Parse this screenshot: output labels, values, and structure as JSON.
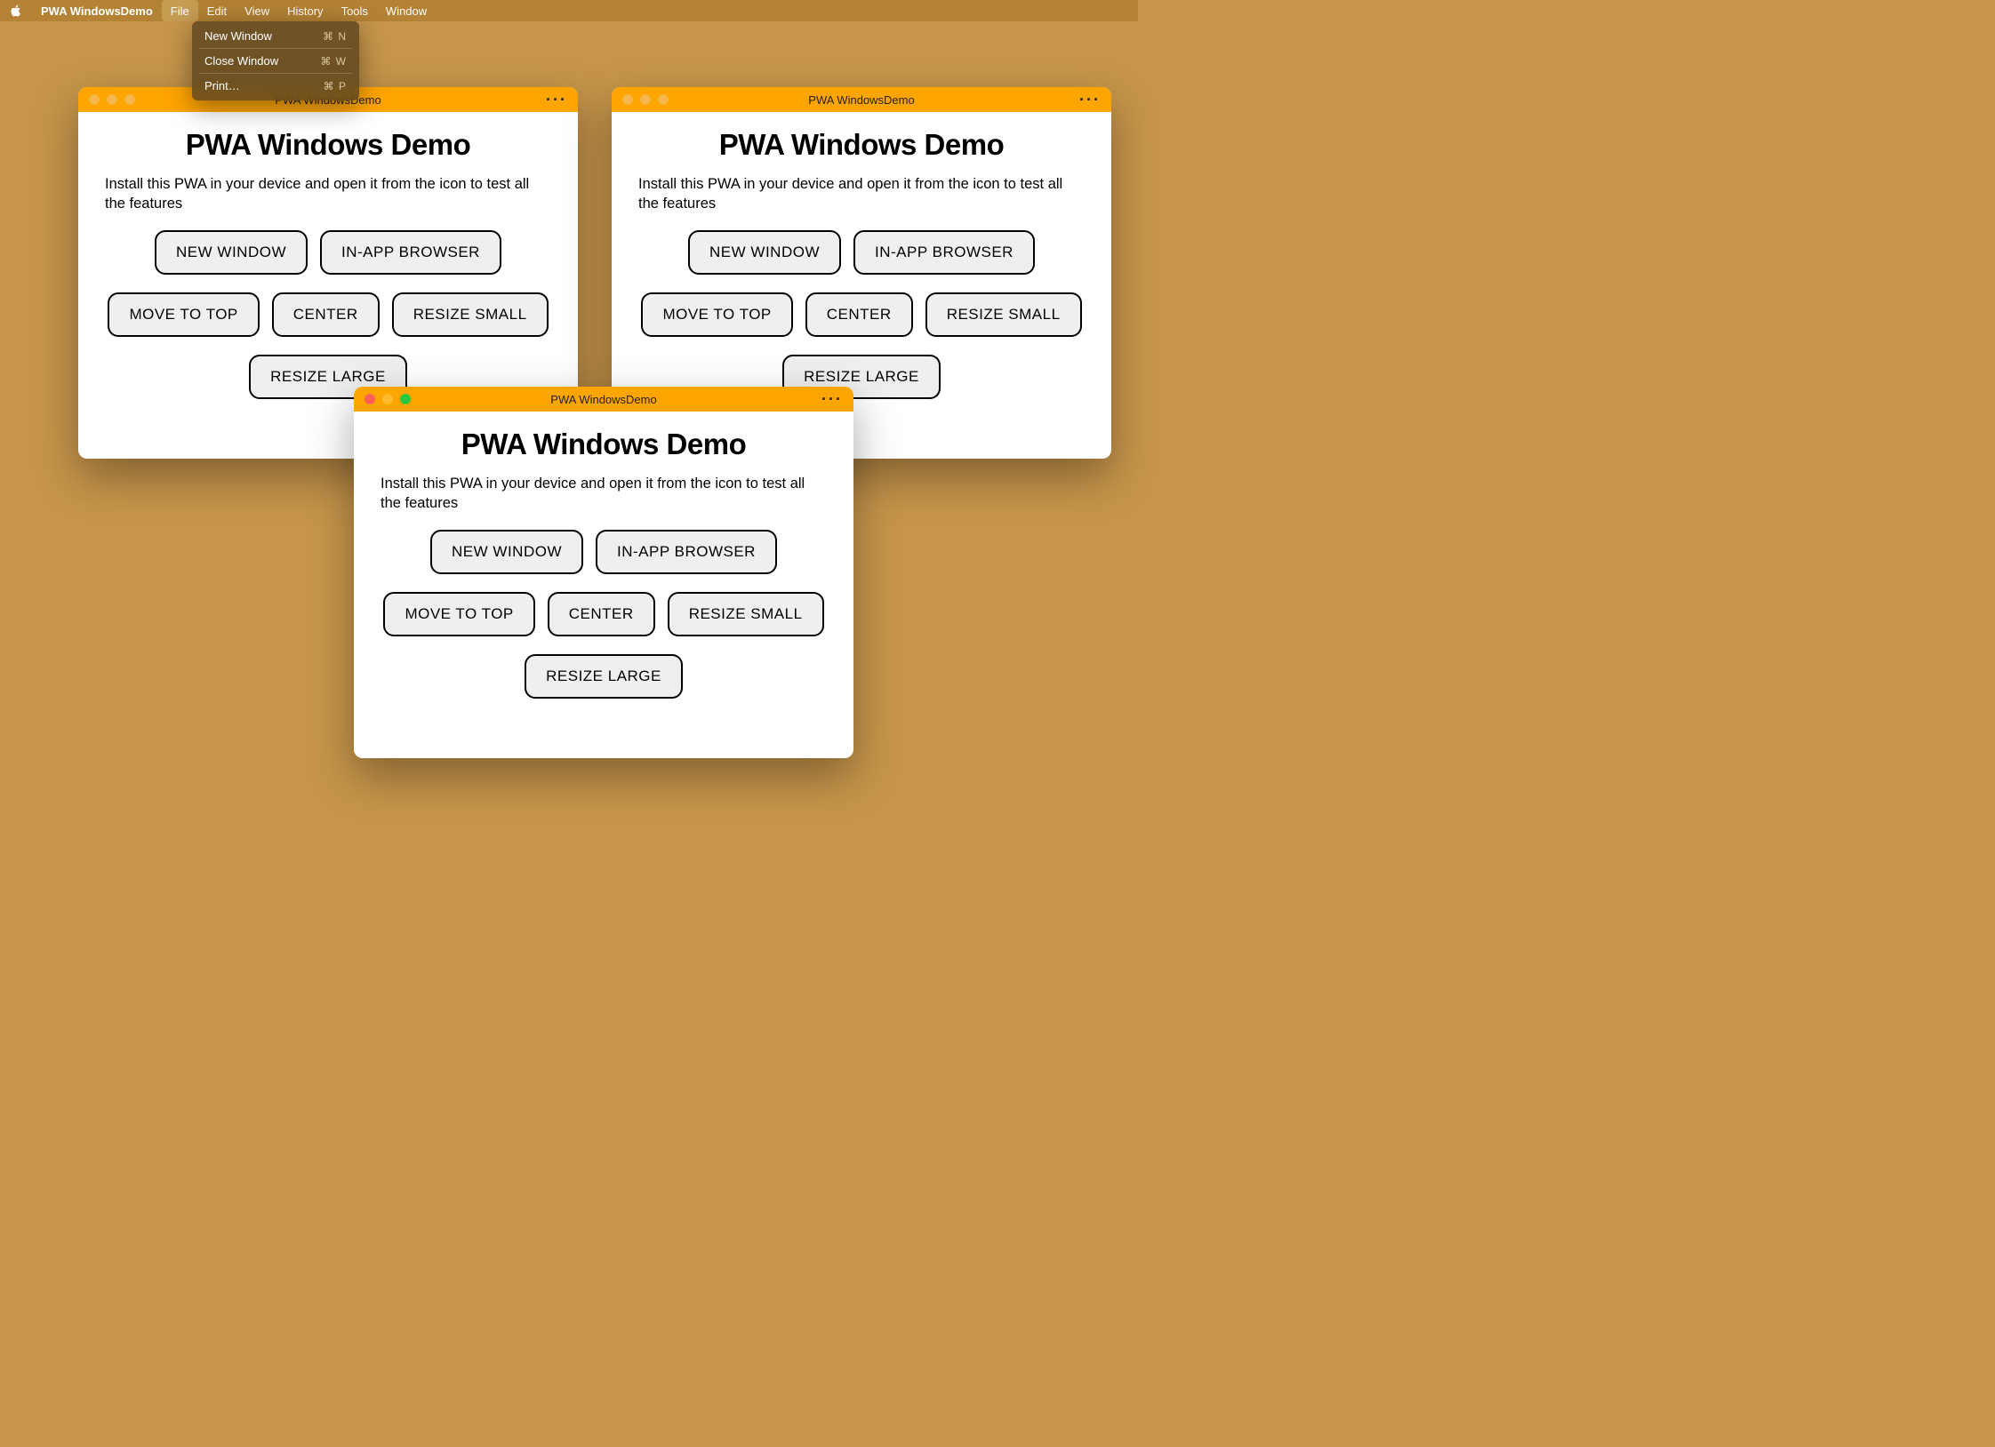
{
  "menubar": {
    "app_name": "PWA WindowsDemo",
    "items": [
      "File",
      "Edit",
      "View",
      "History",
      "Tools",
      "Window"
    ],
    "active_index": 0
  },
  "file_menu": {
    "items": [
      {
        "label": "New Window",
        "shortcut": "⌘ N"
      },
      {
        "label": "Close Window",
        "shortcut": "⌘ W"
      },
      {
        "label": "Print…",
        "shortcut": "⌘ P"
      }
    ]
  },
  "window": {
    "title": "PWA WindowsDemo",
    "content_title": "PWA Windows Demo",
    "description": "Install this PWA in your device and open it from the icon to test all the features",
    "buttons": [
      "NEW WINDOW",
      "IN-APP BROWSER",
      "MOVE TO TOP",
      "CENTER",
      "RESIZE SMALL",
      "RESIZE LARGE"
    ],
    "more_glyph": "···"
  },
  "colors": {
    "desktop": "#c6954a",
    "menubar": "#b38234",
    "titlebar": "#ffa500"
  }
}
